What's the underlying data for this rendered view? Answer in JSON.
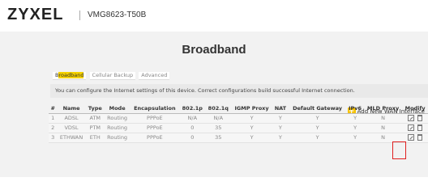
{
  "header": {
    "brand": "ZYXEL",
    "model": "VMG8623-T50B"
  },
  "page": {
    "title": "Broadband"
  },
  "tabs": [
    {
      "label_highlight": "roadband",
      "label_prefix": "B"
    },
    {
      "label": "Cellular Backup"
    },
    {
      "label": "Advanced"
    }
  ],
  "info_text": "You can configure the Internet settings of this device. Correct configurations build successful Internet connection.",
  "add_wan_label": "Add New WAN Interface",
  "table": {
    "headers": [
      "#",
      "Name",
      "Type",
      "Mode",
      "Encapsulation",
      "802.1p",
      "802.1q",
      "IGMP Proxy",
      "NAT",
      "Default Gateway",
      "IPv6",
      "MLD Proxy",
      "Modify"
    ],
    "rows": [
      [
        "1",
        "ADSL",
        "ATM",
        "Routing",
        "PPPoE",
        "N/A",
        "N/A",
        "Y",
        "Y",
        "Y",
        "Y",
        "N"
      ],
      [
        "2",
        "VDSL",
        "PTM",
        "Routing",
        "PPPoE",
        "0",
        "35",
        "Y",
        "Y",
        "Y",
        "Y",
        "N"
      ],
      [
        "3",
        "ETHWAN",
        "ETH",
        "Routing",
        "PPPoE",
        "0",
        "35",
        "Y",
        "Y",
        "Y",
        "Y",
        "N"
      ]
    ]
  },
  "colors": {
    "accent": "#f6d200",
    "highlight_box": "#e02020",
    "panel_bg": "#f2f2f2"
  }
}
